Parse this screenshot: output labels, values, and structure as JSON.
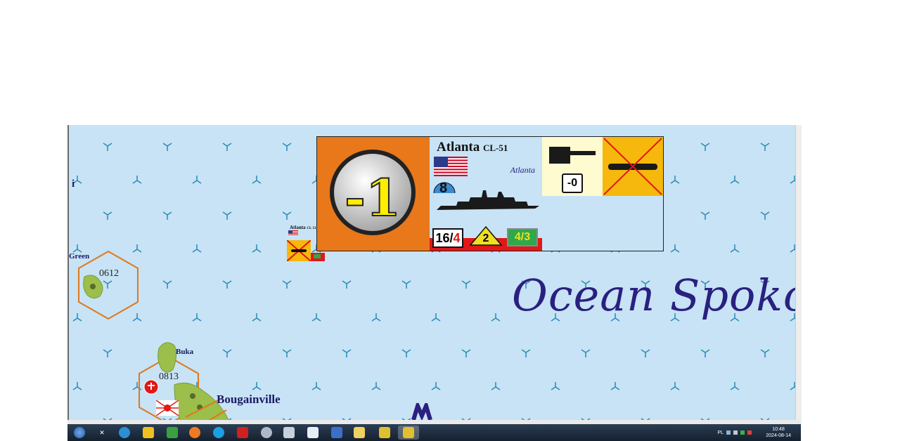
{
  "map": {
    "hexes": [
      {
        "id": "0612"
      },
      {
        "id": "0813"
      }
    ],
    "places": {
      "edge_left_top": "i",
      "edge_left_green": "Green",
      "buka": "Buka",
      "bougainville": "Bougainville"
    },
    "ocean_label": "Ocean Spokojny",
    "colors": {
      "sea": "#c7e3f5",
      "hex_outline": "#e0781a",
      "grid_mark": "#2a8ab8",
      "land": "#9bbf4a"
    }
  },
  "counter": {
    "modifier": "-1",
    "ship_name": "Atlanta",
    "hull_code": "CL-51",
    "class_name": "Atlanta",
    "speed": "8",
    "gun_value_a": "16",
    "gun_value_b": "4",
    "aa_value": "2",
    "armor_value": "4/3",
    "gun_modifier": "-0",
    "flag": "us-flag-icon",
    "torpedo": "torpedo-icon-crossed"
  },
  "mini_counter": {
    "ship_name": "Atlanta",
    "hull_code": "CL-51"
  },
  "taskbar": {
    "icons": [
      "windows-start-icon",
      "close-tab-x",
      "edge-icon",
      "game-icon",
      "chart-icon",
      "firefox-icon",
      "skype-icon",
      "pdf-icon",
      "tool-icon",
      "notes-icon",
      "window-icon",
      "document-icon",
      "folder-icon",
      "game-icon-2",
      "game-icon-3"
    ],
    "tray_lang": "PL",
    "clock_time": "10:48",
    "clock_date": "2024-08-14"
  }
}
